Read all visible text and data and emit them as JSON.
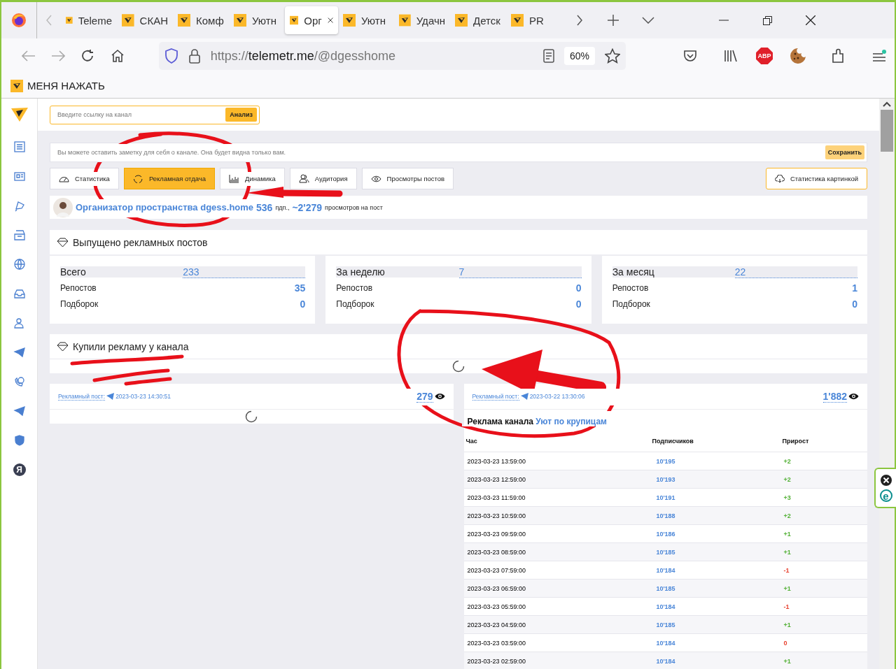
{
  "browser": {
    "tabs": [
      {
        "title": "Teleme",
        "selected": false
      },
      {
        "title": "СКАН",
        "selected": false
      },
      {
        "title": "Комф",
        "selected": false
      },
      {
        "title": "Уютн",
        "selected": false
      },
      {
        "title": "Орг",
        "selected": true
      },
      {
        "title": "Уютн",
        "selected": false
      },
      {
        "title": "Удачн",
        "selected": false
      },
      {
        "title": "Детск",
        "selected": false
      },
      {
        "title": "PR",
        "selected": false
      }
    ],
    "url_scheme": "https://",
    "url_host": "telemetr.me",
    "url_path": "/@dgesshome",
    "zoom": "60%",
    "abp": "ABP",
    "bookmarks": [
      {
        "label": "МЕНЯ НАЖАТЬ"
      }
    ]
  },
  "sidebar": {
    "badge": "Я"
  },
  "search": {
    "placeholder": "Введите ссылку на канал",
    "button": "Анализ"
  },
  "note": {
    "placeholder": "Вы можете оставить заметку для себя о канале. Она будет видна только вам.",
    "button": "Сохранить"
  },
  "tabs": [
    {
      "label": "Статистика",
      "selected": false
    },
    {
      "label": "Рекламная отдача",
      "selected": true
    },
    {
      "label": "Динамика",
      "selected": false
    },
    {
      "label": "Аудитория",
      "selected": false
    },
    {
      "label": "Просмотры постов",
      "selected": false
    }
  ],
  "image_stats_button": "Статистика картинкой",
  "channel": {
    "name": "Организатор пространства dgess.home",
    "subscribers": "536",
    "subscribers_unit": "пдп.,",
    "views": "~2'279",
    "views_unit": "просмотров на пост"
  },
  "released": {
    "title": "Выпущено рекламных постов",
    "groups": [
      {
        "rows": [
          {
            "label": "Всего",
            "value": "233"
          },
          {
            "label": "Репостов",
            "value": "35"
          },
          {
            "label": "Подборок",
            "value": "0"
          }
        ]
      },
      {
        "rows": [
          {
            "label": "За неделю",
            "value": "7"
          },
          {
            "label": "Репостов",
            "value": "0"
          },
          {
            "label": "Подборок",
            "value": "0"
          }
        ]
      },
      {
        "rows": [
          {
            "label": "За месяц",
            "value": "22"
          },
          {
            "label": "Репостов",
            "value": "1"
          },
          {
            "label": "Подборок",
            "value": "0"
          }
        ]
      }
    ]
  },
  "bought": {
    "title": "Купили рекламу у канала"
  },
  "posts": [
    {
      "label": "Рекламный пост:",
      "date": "2023-03-23 14:30:51",
      "views": "279"
    },
    {
      "label": "Рекламный пост:",
      "date": "2023-03-22 13:30:06",
      "views": "1'882",
      "ad_title": "Реклама канала",
      "ad_channel": "Уют по крупицам",
      "columns": [
        "Час",
        "Подписчиков",
        "Прирост"
      ],
      "rows": [
        {
          "time": "2023-03-23 13:59:00",
          "subscribers": "10'195",
          "change": "+2",
          "color": "#52b035"
        },
        {
          "time": "2023-03-23 12:59:00",
          "subscribers": "10'193",
          "change": "+2",
          "color": "#52b035"
        },
        {
          "time": "2023-03-23 11:59:00",
          "subscribers": "10'191",
          "change": "+3",
          "color": "#52b035"
        },
        {
          "time": "2023-03-23 10:59:00",
          "subscribers": "10'188",
          "change": "+2",
          "color": "#52b035"
        },
        {
          "time": "2023-03-23 09:59:00",
          "subscribers": "10'186",
          "change": "+1",
          "color": "#52b035"
        },
        {
          "time": "2023-03-23 08:59:00",
          "subscribers": "10'185",
          "change": "+1",
          "color": "#52b035"
        },
        {
          "time": "2023-03-23 07:59:00",
          "subscribers": "10'184",
          "change": "-1",
          "color": "#e8412f"
        },
        {
          "time": "2023-03-23 06:59:00",
          "subscribers": "10'185",
          "change": "+1",
          "color": "#52b035"
        },
        {
          "time": "2023-03-23 05:59:00",
          "subscribers": "10'184",
          "change": "-1",
          "color": "#e8412f"
        },
        {
          "time": "2023-03-23 04:59:00",
          "subscribers": "10'185",
          "change": "+1",
          "color": "#52b035"
        },
        {
          "time": "2023-03-23 03:59:00",
          "subscribers": "10'184",
          "change": "0",
          "color": "#e8412f"
        },
        {
          "time": "2023-03-23 02:59:00",
          "subscribers": "10'184",
          "change": "+1",
          "color": "#52b035"
        }
      ]
    }
  ],
  "side_widget": {
    "label": "e"
  }
}
